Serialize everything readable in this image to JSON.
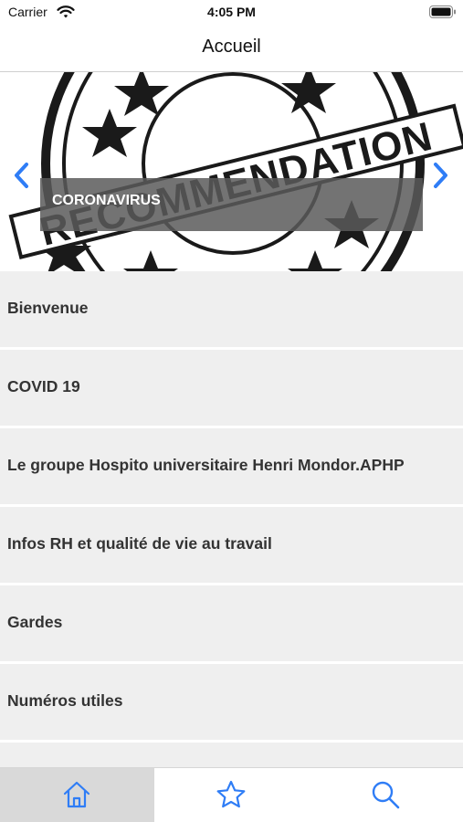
{
  "status_bar": {
    "carrier": "Carrier",
    "time": "4:05 PM",
    "icons": [
      "wifi-icon",
      "battery-icon"
    ]
  },
  "nav": {
    "title": "Accueil"
  },
  "carousel": {
    "image_text": "RECOMMENDATION",
    "caption": "CORONAVIRUS",
    "icons": [
      "chevron-left-icon",
      "chevron-right-icon"
    ]
  },
  "menu": {
    "items": [
      {
        "label": "Bienvenue"
      },
      {
        "label": "COVID 19"
      },
      {
        "label": "Le groupe Hospito universitaire Henri Mondor.APHP"
      },
      {
        "label": "Infos RH et qualité de vie au travail"
      },
      {
        "label": "Gardes"
      },
      {
        "label": "Numéros utiles"
      }
    ]
  },
  "tab_bar": {
    "tabs": [
      {
        "icon": "home-icon",
        "selected": true
      },
      {
        "icon": "star-icon",
        "selected": false
      },
      {
        "icon": "search-icon",
        "selected": false
      }
    ]
  },
  "colors": {
    "accent": "#2f7df6",
    "list_background": "#efefef",
    "caption_background": "#5a5a5a",
    "selected_tab": "#d9d9d9"
  }
}
